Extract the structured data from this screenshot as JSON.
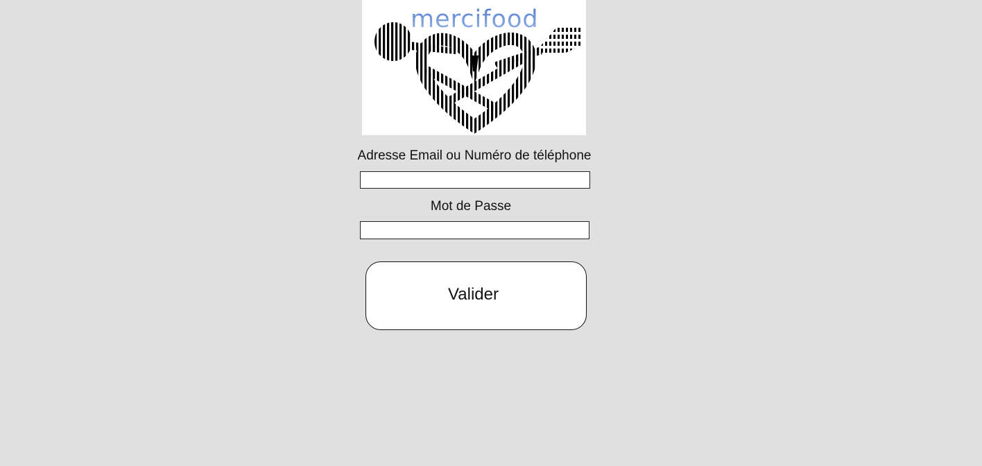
{
  "logo": {
    "wordmark": "mercifood",
    "icon": "heart-with-spoon-and-fork-logo"
  },
  "form": {
    "email_label": "Adresse Email ou Numéro de téléphone",
    "email_value": "",
    "password_label": "Mot de Passe",
    "password_value": "",
    "submit_label": "Valider"
  },
  "colors": {
    "background": "#e0e0e0",
    "wordmark": "#6b8fd6",
    "field_background": "#ffffff"
  }
}
